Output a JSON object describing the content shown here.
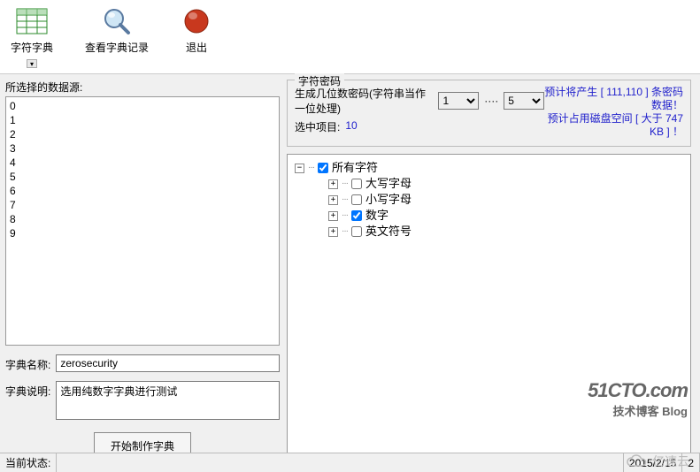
{
  "toolbar": {
    "dict_label": "字符字典",
    "view_label": "查看字典记录",
    "exit_label": "退出"
  },
  "left": {
    "source_label": "所选择的数据源:",
    "items": [
      "0",
      "1",
      "2",
      "3",
      "4",
      "5",
      "6",
      "7",
      "8",
      "9"
    ],
    "name_label": "字典名称:",
    "name_value": "zerosecurity",
    "desc_label": "字典说明:",
    "desc_value": "选用纯数字字典进行测试",
    "start_label": "开始制作字典"
  },
  "group": {
    "legend": "字符密码",
    "gen_label": "生成几位数密码(字符串当作一位处理)",
    "min": "1",
    "max": "5",
    "dots": "····",
    "sel_label": "选中项目:",
    "sel_value": "10",
    "pred1": "预计将产生 [ 111,110 ] 条密码数据！",
    "pred2": "预计占用磁盘空间 [ 大于 747 KB ] ！"
  },
  "tree": {
    "root": "所有字符",
    "nodes": [
      "大写字母",
      "小写字母",
      "数字",
      "英文符号"
    ]
  },
  "status": {
    "label": "当前状态:",
    "date": "2015/2/15",
    "extra": "2"
  },
  "watermark": {
    "big": "51CTO.com",
    "small": "技术博客   Blog",
    "brand": "亿速云"
  }
}
